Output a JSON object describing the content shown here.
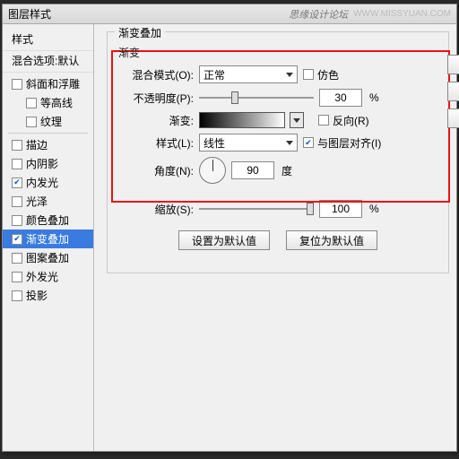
{
  "window": {
    "title": "图层样式",
    "brand": "思缘设计论坛",
    "url": "WWW.MISSYUAN.COM"
  },
  "sidebar": {
    "heading": "样式",
    "section": "混合选项:默认",
    "items": [
      {
        "label": "斜面和浮雕",
        "checked": false,
        "indent": false
      },
      {
        "label": "等高线",
        "checked": false,
        "indent": true
      },
      {
        "label": "纹理",
        "checked": false,
        "indent": true
      },
      {
        "label": "描边",
        "checked": false,
        "indent": false
      },
      {
        "label": "内阴影",
        "checked": false,
        "indent": false
      },
      {
        "label": "内发光",
        "checked": true,
        "indent": false
      },
      {
        "label": "光泽",
        "checked": false,
        "indent": false
      },
      {
        "label": "颜色叠加",
        "checked": false,
        "indent": false
      },
      {
        "label": "渐变叠加",
        "checked": true,
        "indent": false,
        "selected": true
      },
      {
        "label": "图案叠加",
        "checked": false,
        "indent": false
      },
      {
        "label": "外发光",
        "checked": false,
        "indent": false
      },
      {
        "label": "投影",
        "checked": false,
        "indent": false
      }
    ]
  },
  "panel": {
    "title": "渐变叠加",
    "subtitle": "渐变",
    "blend": {
      "label": "混合模式(O):",
      "value": "正常"
    },
    "dither": {
      "label": "仿色",
      "checked": false
    },
    "opacity": {
      "label": "不透明度(P):",
      "value": "30",
      "unit": "%",
      "thumb_pct": 30
    },
    "gradient": {
      "label": "渐变:"
    },
    "reverse": {
      "label": "反向(R)",
      "checked": false
    },
    "style": {
      "label": "样式(L):",
      "value": "线性"
    },
    "align": {
      "label": "与图层对齐(I)",
      "checked": true
    },
    "angle": {
      "label": "角度(N):",
      "value": "90",
      "unit": "度"
    },
    "scale": {
      "label": "缩放(S):",
      "value": "100",
      "unit": "%",
      "thumb_pct": 100
    },
    "buttons": {
      "default": "设置为默认值",
      "reset": "复位为默认值"
    }
  },
  "rail": {
    "ok": "",
    "cancel": "",
    "new": ""
  }
}
